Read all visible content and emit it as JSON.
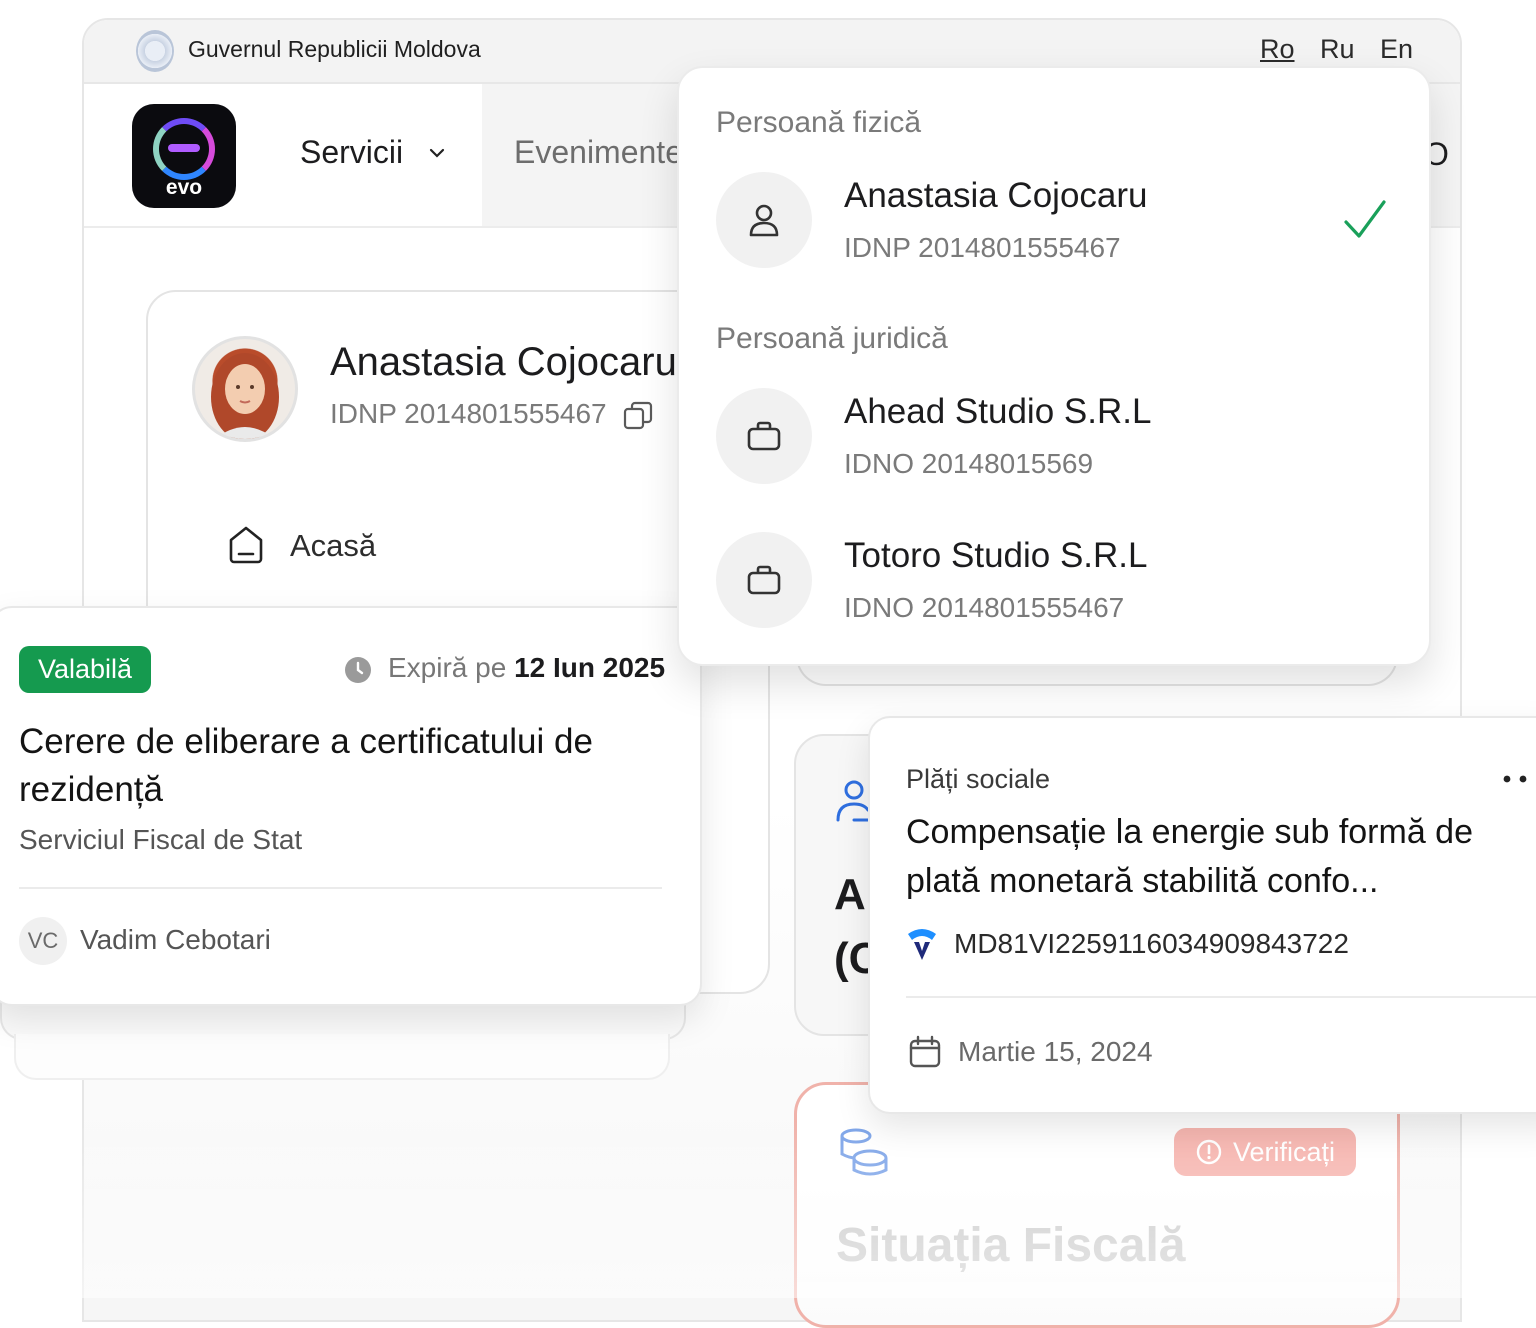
{
  "gov_bar": {
    "title": "Guvernul Republicii Moldova",
    "languages": [
      "Ro",
      "Ru",
      "En"
    ],
    "active_language": "Ro"
  },
  "nav": {
    "logo_text": "evo",
    "items": [
      "Servicii",
      "Evenimente",
      "O"
    ]
  },
  "profile": {
    "name": "Anastasia Cojocaru",
    "idnp": "IDNP 2014801555467",
    "menu": [
      {
        "label": "Acasă",
        "icon": "home-icon"
      }
    ]
  },
  "account_dropdown": {
    "sections": [
      {
        "heading": "Persoană fizică",
        "accounts": [
          {
            "name": "Anastasia Cojocaru",
            "id": "IDNP 2014801555467",
            "icon": "user-icon",
            "selected": true
          }
        ]
      },
      {
        "heading": "Persoană juridică",
        "accounts": [
          {
            "name": "Ahead Studio S.R.L",
            "id": "IDNO 20148015569",
            "icon": "briefcase-icon",
            "selected": false
          },
          {
            "name": "Totoro Studio S.R.L",
            "id": "IDNO 2014801555467",
            "icon": "briefcase-icon",
            "selected": false
          }
        ]
      }
    ]
  },
  "document_card": {
    "status": "Valabilă",
    "expires_prefix": "Expiră pe",
    "expires_date": "12 Iun 2025",
    "title": "Cerere de eliberare a certificatului de rezidență",
    "issuer": "Serviciul Fiscal de Stat",
    "owner_initials": "VC",
    "owner_name": "Vadim Cebotari"
  },
  "payment_card": {
    "category": "Plăți sociale",
    "title": "Compensație la energie sub formă de plată monetară stabilită confo...",
    "iban": "MD81VI225911603490984​3722",
    "date": "Martie 15, 2024"
  },
  "background_cards": {
    "mid_text_line1": "A",
    "mid_text_line2": "(C",
    "fiscal_badge": "Verificați",
    "fiscal_title": "Situația Fiscală"
  },
  "colors": {
    "valid_green": "#159a4f",
    "check_green": "#1aa05a",
    "warning_red": "#f6b4ae",
    "accent_purple": "#6f4cf6",
    "accent_blue": "#2f6fe0"
  }
}
